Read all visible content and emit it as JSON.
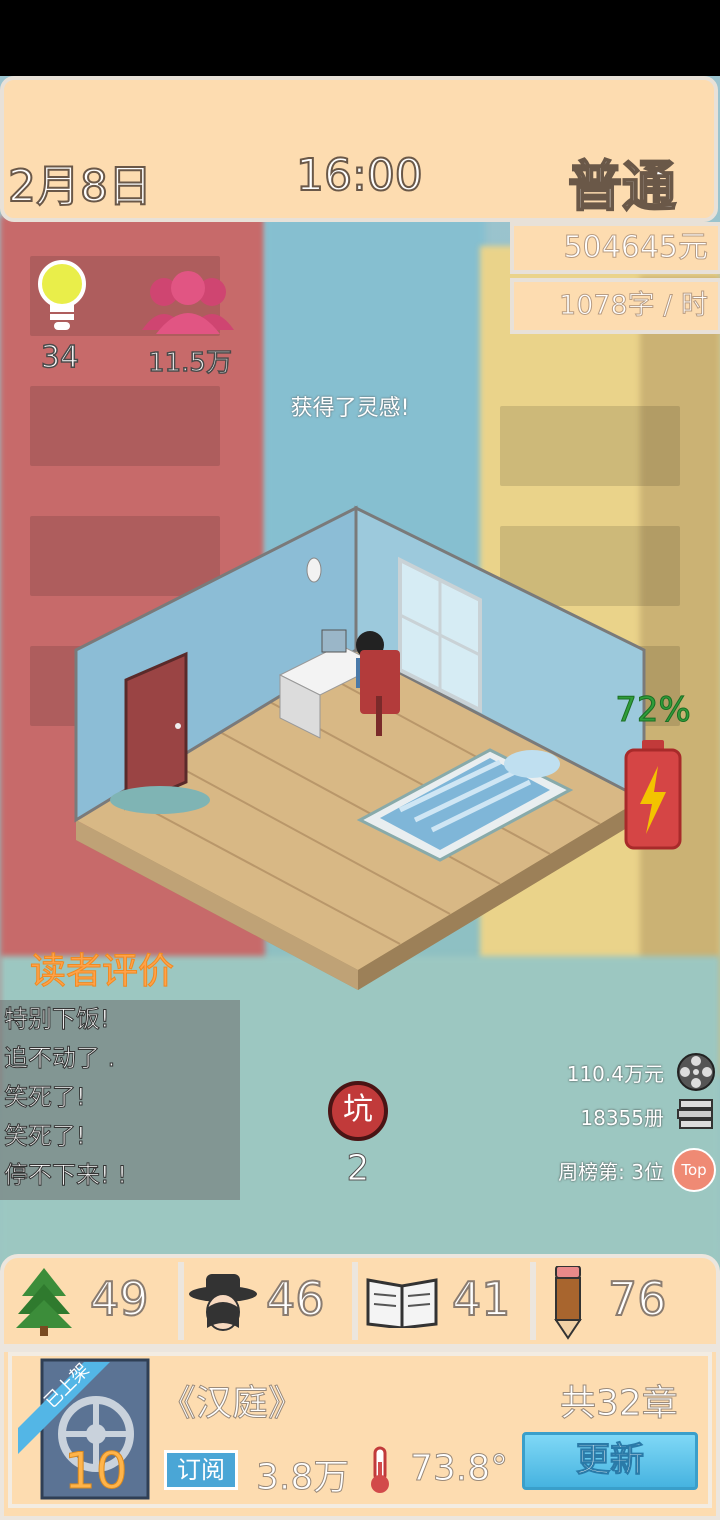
{
  "header": {
    "date": "2月8日",
    "time": "16:00",
    "difficulty": "普通"
  },
  "finance": {
    "money": "504645元",
    "speed": "1078字 / 时"
  },
  "stats": {
    "inspiration": "34",
    "fans": "11.5万"
  },
  "notice": "获得了灵感!",
  "battery": {
    "percent_label": "72%",
    "level": 0.72
  },
  "reviews": {
    "title": "读者评价",
    "items": [
      "特别下饭!",
      "追不动了 .",
      "笑死了!",
      "笑死了!",
      "停不下来! !"
    ]
  },
  "pit": {
    "icon_label": "坑",
    "count": "2"
  },
  "sales": {
    "revenue": "110.4万元",
    "copies": "18355册",
    "rank": "周榜第: 3位",
    "top_badge": "Top"
  },
  "attributes": [
    {
      "icon": "tree-icon",
      "value": "49"
    },
    {
      "icon": "detective-icon",
      "value": "46"
    },
    {
      "icon": "book-icon",
      "value": "41"
    },
    {
      "icon": "pencil-icon",
      "value": "76"
    }
  ],
  "book": {
    "ribbon": "已上架",
    "cover_number": "10",
    "title": "《汉庭》",
    "chapters": "共32章",
    "subscribe_label": "订阅",
    "subscribers": "3.8万",
    "heat": "73.8°",
    "update_button": "更新"
  },
  "colors": {
    "panel": "#fddcb0",
    "accent_orange": "#ffa24a",
    "battery_red": "#d9534f",
    "update_blue": "#5cc6e8"
  }
}
